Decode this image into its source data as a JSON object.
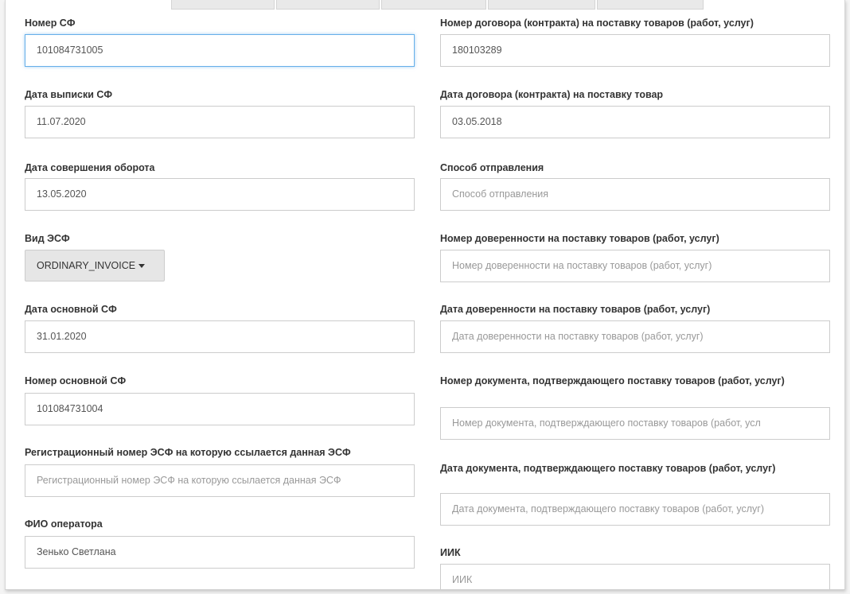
{
  "left": {
    "sf_number": {
      "label": "Номер СФ",
      "value": "101084731005"
    },
    "issue_date": {
      "label": "Дата выписки СФ",
      "value": "11.07.2020"
    },
    "turnover_date": {
      "label": "Дата совершения оборота",
      "value": "13.05.2020"
    },
    "esf_type": {
      "label": "Вид ЭСФ",
      "value": "ORDINARY_INVOICE"
    },
    "main_sf_date": {
      "label": "Дата основной СФ",
      "value": "31.01.2020"
    },
    "main_sf_number": {
      "label": "Номер основной СФ",
      "value": "101084731004"
    },
    "reg_number": {
      "label": "Регистрационный номер ЭСФ на которую ссылается данная ЭСФ",
      "placeholder": "Регистрационный номер ЭСФ на которую ссылается данная ЭСФ"
    },
    "operator": {
      "label": "ФИО оператора",
      "value": "Зенько Светлана"
    }
  },
  "right": {
    "contract_number": {
      "label": "Номер договора (контракта) на поставку товаров (работ, услуг)",
      "value": "180103289"
    },
    "contract_date": {
      "label": "Дата договора (контракта) на поставку товар",
      "value": "03.05.2018"
    },
    "shipping_method": {
      "label": "Способ отправления",
      "placeholder": "Способ отправления"
    },
    "poa_number": {
      "label": "Номер доверенности на поставку товаров (работ, услуг)",
      "placeholder": "Номер доверенности на поставку товаров (работ, услуг)"
    },
    "poa_date": {
      "label": "Дата доверенности на поставку товаров (работ, услуг)",
      "placeholder": "Дата доверенности на поставку товаров (работ, услуг)"
    },
    "doc_number": {
      "label": "Номер документа, подтверждающего поставку товаров (работ, услуг)",
      "placeholder": "Номер документа, подтверждающего поставку товаров (работ, усл"
    },
    "doc_date": {
      "label": "Дата документа, подтверждающего поставку товаров (работ, услуг)",
      "placeholder": "Дата документа, подтверждающего поставку товаров (работ, услуг)"
    },
    "iik": {
      "label": "ИИК",
      "placeholder": "ИИК"
    }
  }
}
